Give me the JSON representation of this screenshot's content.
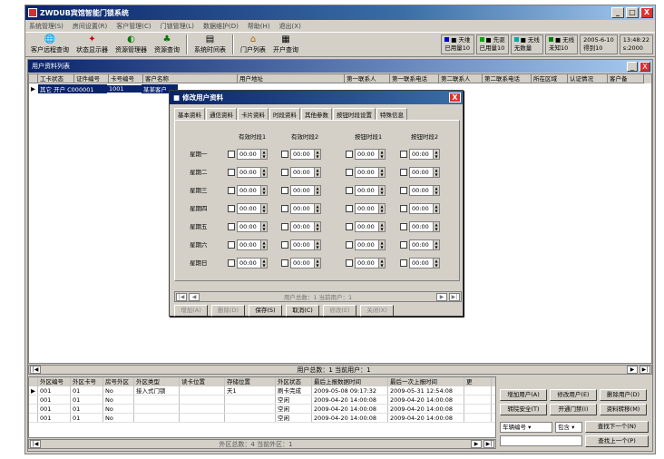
{
  "window": {
    "title": "ZWDUB宾馆智能门锁系统",
    "min": "_",
    "max": "□",
    "close": "X"
  },
  "menu": [
    "系统管理(S)",
    "房间设置(R)",
    "客户管理(C)",
    "门锁管理(L)",
    "数据维护(D)",
    "帮助(H)",
    "退出(X)"
  ],
  "toolbar": [
    {
      "icon": "🌐",
      "label": "客户远程查询"
    },
    {
      "icon": "✦",
      "label": "状态显示器"
    },
    {
      "icon": "◐",
      "label": "资源管理器"
    },
    {
      "icon": "♣",
      "label": "资源查询"
    },
    {
      "icon": "▤",
      "label": "系统时间表"
    },
    {
      "icon": "⌂",
      "label": "门户列表"
    },
    {
      "icon": "▦",
      "label": "开户查询"
    }
  ],
  "status": [
    {
      "line1": "■ 天维",
      "line2": "已用量10",
      "color": "#0000cc"
    },
    {
      "line1": "■ 先驱",
      "line2": "已用量10",
      "color": "#00aa00"
    },
    {
      "line1": "■ 无线",
      "line2": "无数量",
      "color": "#00aaaa"
    },
    {
      "line1": "■ 无线",
      "line2": "未知10",
      "color": "#008000"
    },
    {
      "line1": "2005-6-10",
      "line2": "得到10"
    },
    {
      "line1": "13:48:22",
      "line2": "s:2000"
    }
  ],
  "child": {
    "title": "用户资料列表"
  },
  "grid": {
    "columns": [
      "工卡状态",
      "证件编号",
      "卡号编号",
      "客户名称",
      "用户地址",
      "第一联系人",
      "第一联系电话",
      "第二联系人",
      "第二联系电话",
      "所在区域",
      "认证情况",
      "客户备"
    ],
    "row": [
      "其它 开户 C000001",
      "1001",
      "某某客户"
    ]
  },
  "grid_nav": {
    "text": "用户总数：1 当前用户：1"
  },
  "bottom_grid": {
    "columns": [
      "外区编号",
      "外区卡号",
      "房号外区",
      "外区类型",
      "读卡位置",
      "存储位置",
      "外区状态",
      "最后上报数据时间",
      "最后一次上报时间",
      "更"
    ],
    "rows": [
      [
        "001",
        "01",
        "No",
        "接入式门锁",
        "",
        "天1",
        "刷卡完成",
        "2009-05-08 09:17:32",
        "2009-05-31 12:54:08",
        ""
      ],
      [
        "001",
        "01",
        "No",
        "",
        "",
        "",
        "空闲",
        "2009-04-20 14:00:08",
        "2009-04-20 14:00:08",
        ""
      ],
      [
        "001",
        "01",
        "No",
        "",
        "",
        "",
        "空闲",
        "2009-04-20 14:00:08",
        "2009-04-20 14:00:08",
        ""
      ],
      [
        "001",
        "01",
        "No",
        "",
        "",
        "",
        "空闲",
        "2009-04-20 14:00:08",
        "2009-04-20 14:00:08",
        ""
      ]
    ],
    "nav_text": "外区总数：4 当前外区：1"
  },
  "right_panel": {
    "buttons": [
      "增加用户(A)",
      "修改用户(E)",
      "删除用户(D)",
      "转院安全(T)",
      "开通门禁(I)",
      "资料转移(M)"
    ],
    "select1": "车辆编号",
    "select2": "包含",
    "find_next": "查找下一个(N)",
    "find_prev": "查找上一个(P)"
  },
  "dialog": {
    "title": "修改用户资料",
    "close": "X",
    "tabs": [
      "基本资料",
      "通信资料",
      "卡片资料",
      "时段资料",
      "其他参数",
      "按钮时段设置",
      "特殊信息"
    ],
    "active_tab": 5,
    "col_headers": [
      "有效时段1",
      "有效时段2",
      "按钮时段1",
      "按钮时段2"
    ],
    "days": [
      "星期一",
      "星期二",
      "星期三",
      "星期四",
      "星期五",
      "星期六",
      "星期日"
    ],
    "time1": "00:00",
    "time2": "00:00",
    "time3": "00:00",
    "time4": "00:00",
    "nav_text": "用户总数：1 当前用户：1",
    "buttons": [
      "增加(A)",
      "删除(D)",
      "保存(S)",
      "取消(C)",
      "修改(E)",
      "关闭(X)"
    ]
  }
}
